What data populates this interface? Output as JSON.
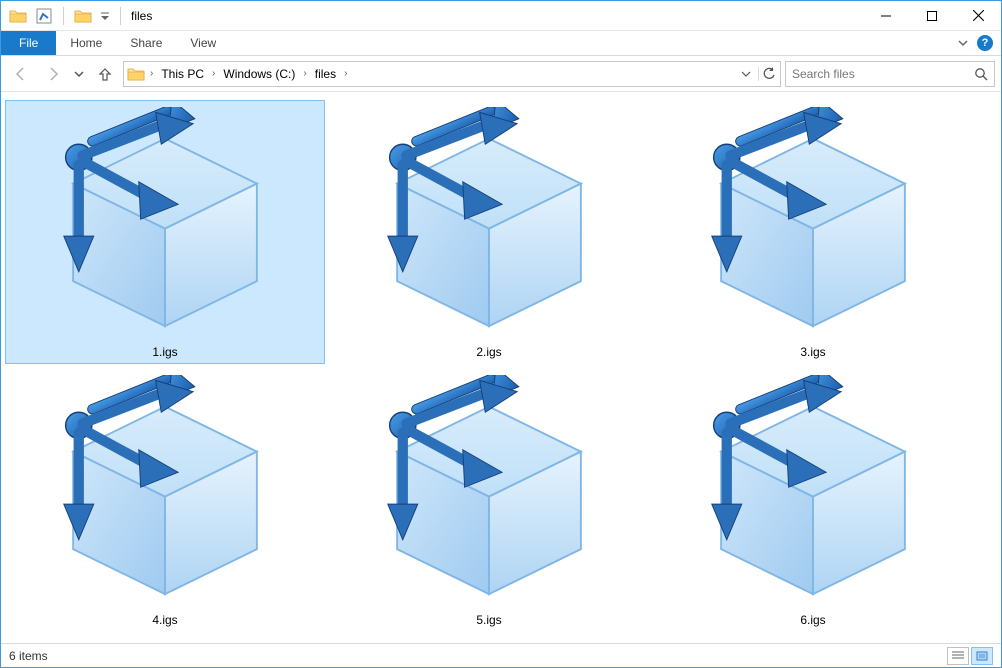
{
  "window": {
    "title": "files"
  },
  "ribbon": {
    "file": "File",
    "tabs": [
      "Home",
      "Share",
      "View"
    ]
  },
  "breadcrumb": {
    "items": [
      "This PC",
      "Windows (C:)",
      "files"
    ]
  },
  "search": {
    "placeholder": "Search files"
  },
  "files": [
    {
      "name": "1.igs",
      "selected": true
    },
    {
      "name": "2.igs",
      "selected": false
    },
    {
      "name": "3.igs",
      "selected": false
    },
    {
      "name": "4.igs",
      "selected": false
    },
    {
      "name": "5.igs",
      "selected": false
    },
    {
      "name": "6.igs",
      "selected": false
    }
  ],
  "status": {
    "text": "6 items"
  }
}
